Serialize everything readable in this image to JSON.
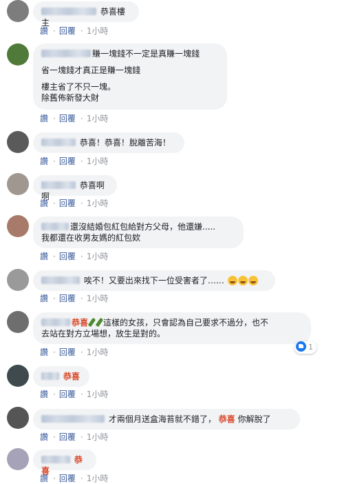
{
  "actions": {
    "like": "讚",
    "reply": "回覆",
    "sep": "·",
    "time": "1小時"
  },
  "comments": [
    {
      "text": "恭喜樓主"
    },
    {
      "lines": [
        "賺一塊錢不一定是真賺一塊錢",
        "省一塊錢才真正是賺一塊錢",
        "樓主省了不只一塊。",
        "除舊佈新發大財"
      ]
    },
    {
      "text": "恭喜！恭喜！脫離苦海！"
    },
    {
      "text": "恭喜啊啊"
    },
    {
      "lines": [
        "還沒結婚包紅包給對方父母，他還嫌.....",
        "我都還在收男友媽的紅包欸"
      ]
    },
    {
      "text": "唉不！又要出來找下一位受害者了……"
    },
    {
      "tag": "恭喜",
      "lines": [
        "這樣的女孩，只會認為自己要求不過分，也不",
        "去站在對方立場想，放生是對的。"
      ]
    },
    {
      "tag": "恭喜"
    },
    {
      "text_before": "才兩個月送盒海苔就不錯了，",
      "tag": "恭喜",
      "text_after": "你解脫了"
    },
    {
      "tag": "恭喜"
    }
  ],
  "reaction": {
    "icon": "like-icon",
    "count": "1"
  },
  "colors": {
    "link": "#365899",
    "meta_gray": "#90949c",
    "bubble": "#f2f3f5",
    "tag": "#d94a2b",
    "like": "#1877f2"
  }
}
